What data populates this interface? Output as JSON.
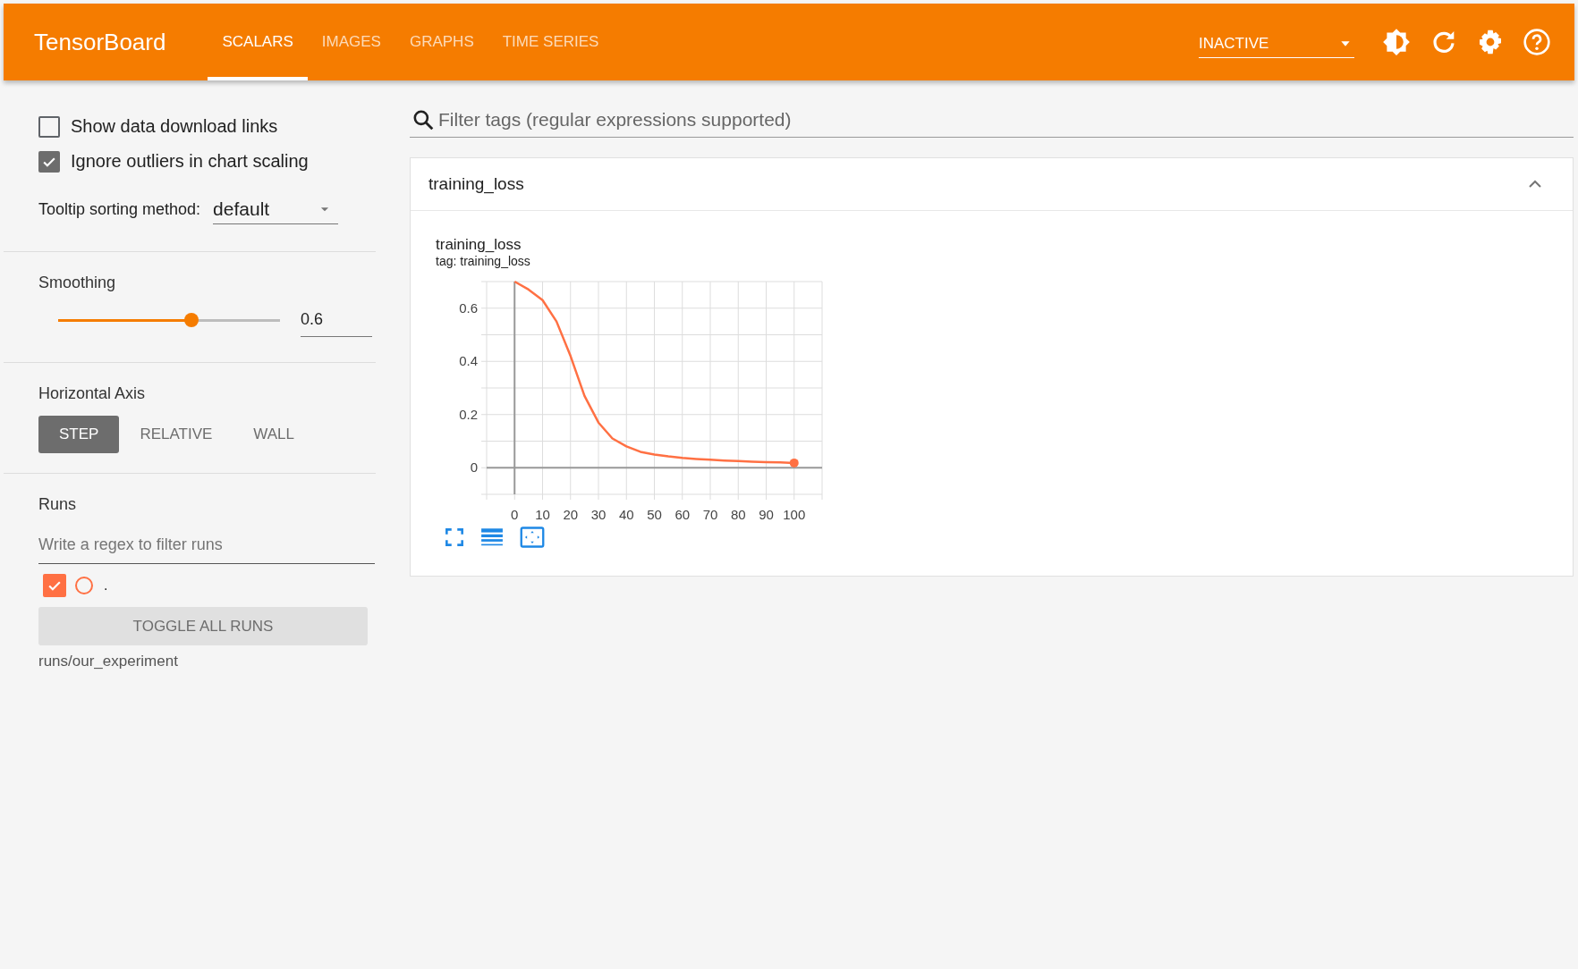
{
  "header": {
    "title": "TensorBoard",
    "tabs": [
      {
        "label": "SCALARS",
        "selected": true
      },
      {
        "label": "IMAGES",
        "selected": false
      },
      {
        "label": "GRAPHS",
        "selected": false
      },
      {
        "label": "TIME SERIES",
        "selected": false
      }
    ],
    "run_state": {
      "value": "INACTIVE"
    }
  },
  "sidebar": {
    "checkboxes": [
      {
        "label": "Show data download links",
        "checked": false
      },
      {
        "label": "Ignore outliers in chart scaling",
        "checked": true
      }
    ],
    "tooltip_sorting": {
      "label": "Tooltip sorting method:",
      "value": "default"
    },
    "smoothing": {
      "title": "Smoothing",
      "level": 0.6,
      "value": "0.6"
    },
    "horizontal_axis": {
      "title": "Horizontal Axis",
      "options": [
        {
          "label": "STEP",
          "selected": true
        },
        {
          "label": "RELATIVE",
          "selected": false
        },
        {
          "label": "WALL",
          "selected": false
        }
      ]
    },
    "runs": {
      "title": "Runs",
      "filter": {
        "placeholder": "Write a regex to filter runs"
      },
      "items": [
        {
          "label": ".",
          "checked": true,
          "color": "#ff7043"
        }
      ],
      "toggle_button": "TOGGLE ALL RUNS",
      "directory": "runs/our_experiment"
    }
  },
  "main": {
    "filter": {
      "placeholder": "Filter tags (regular expressions supported)"
    },
    "cards": [
      {
        "title": "training_loss",
        "expanded": true,
        "charts": [
          {
            "title": "training_loss",
            "subtitle": "tag: training_loss",
            "chart_data": {
              "type": "line",
              "x": [
                0,
                5,
                10,
                15,
                20,
                25,
                30,
                35,
                40,
                45,
                50,
                55,
                60,
                65,
                70,
                75,
                80,
                85,
                90,
                95,
                100
              ],
              "grid": true,
              "series": [
                {
                  "color": "#ff7043",
                  "values": [
                    0.7,
                    0.67,
                    0.63,
                    0.55,
                    0.42,
                    0.27,
                    0.17,
                    0.11,
                    0.08,
                    0.06,
                    0.05,
                    0.043,
                    0.037,
                    0.033,
                    0.03,
                    0.027,
                    0.025,
                    0.023,
                    0.021,
                    0.02,
                    0.018
                  ]
                }
              ],
              "xlim": [
                -10,
                110
              ],
              "ylim": [
                -0.1,
                0.7
              ],
              "xticks": [
                0,
                10,
                20,
                30,
                40,
                50,
                60,
                70,
                80,
                90,
                100
              ],
              "yticks": [
                0,
                0.2,
                0.4,
                0.6
              ]
            }
          }
        ]
      }
    ]
  }
}
